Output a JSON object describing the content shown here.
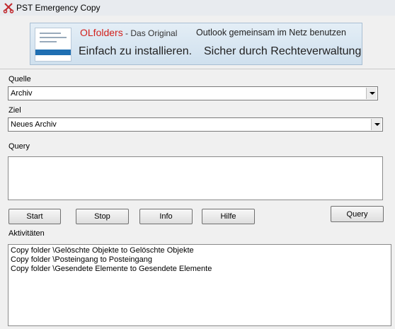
{
  "window": {
    "title": "PST Emergency Copy",
    "icon": "scissors-icon"
  },
  "banner": {
    "brand": "OLfolders",
    "tagline": " - Das Original",
    "slogan_right": "Outlook gemeinsam im Netz benutzen",
    "line2_left": "Einfach zu installieren.",
    "line2_right": "Sicher durch Rechteverwaltung.",
    "brand_color": "#d2201c"
  },
  "source": {
    "label": "Quelle",
    "value": "Archiv"
  },
  "target": {
    "label": "Ziel",
    "value": "Neues Archiv"
  },
  "query": {
    "label": "Query",
    "value": ""
  },
  "buttons": {
    "start": "Start",
    "stop": "Stop",
    "info": "Info",
    "help": "Hilfe",
    "query": "Query"
  },
  "activities": {
    "label": "Aktivitäten",
    "lines": [
      "Copy folder \\Gelöschte Objekte to Gelöschte Objekte",
      "Copy folder \\Posteingang to Posteingang",
      "Copy folder \\Gesendete Elemente to Gesendete Elemente"
    ]
  }
}
